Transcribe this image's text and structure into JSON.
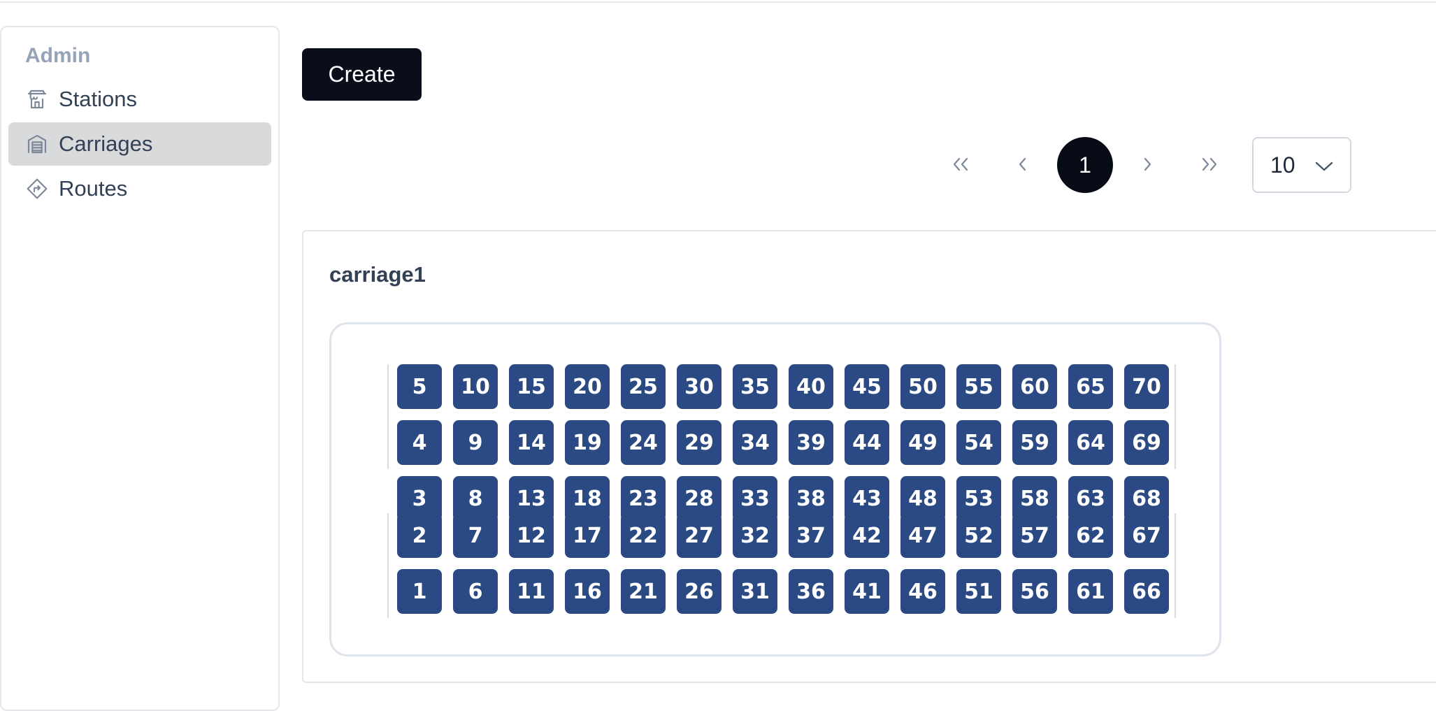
{
  "sidebar": {
    "section_title": "Admin",
    "items": [
      {
        "label": "Stations",
        "icon": "station-icon",
        "active": false
      },
      {
        "label": "Carriages",
        "icon": "carriage-icon",
        "active": true
      },
      {
        "label": "Routes",
        "icon": "route-sign-icon",
        "active": false
      }
    ]
  },
  "toolbar": {
    "create_label": "Create"
  },
  "pagination": {
    "first_label": "«",
    "prev_label": "‹",
    "current_page": "1",
    "next_label": "›",
    "last_label": "»",
    "page_size": "10"
  },
  "carriages": [
    {
      "name": "carriage1",
      "upper_rows": [
        [
          "5",
          "10",
          "15",
          "20",
          "25",
          "30",
          "35",
          "40",
          "45",
          "50",
          "55",
          "60",
          "65",
          "70"
        ],
        [
          "4",
          "9",
          "14",
          "19",
          "24",
          "29",
          "34",
          "39",
          "44",
          "49",
          "54",
          "59",
          "64",
          "69"
        ],
        [
          "3",
          "8",
          "13",
          "18",
          "23",
          "28",
          "33",
          "38",
          "43",
          "48",
          "53",
          "58",
          "63",
          "68"
        ]
      ],
      "lower_rows": [
        [
          "2",
          "7",
          "12",
          "17",
          "22",
          "27",
          "32",
          "37",
          "42",
          "47",
          "52",
          "57",
          "62",
          "67"
        ],
        [
          "1",
          "6",
          "11",
          "16",
          "21",
          "26",
          "31",
          "36",
          "41",
          "46",
          "51",
          "56",
          "61",
          "66"
        ]
      ]
    }
  ],
  "colors": {
    "primary_button": "#0a0e1a",
    "seat": "#2b4a83",
    "active_sidebar": "#d9dadc",
    "muted_text": "#94a3b8"
  }
}
